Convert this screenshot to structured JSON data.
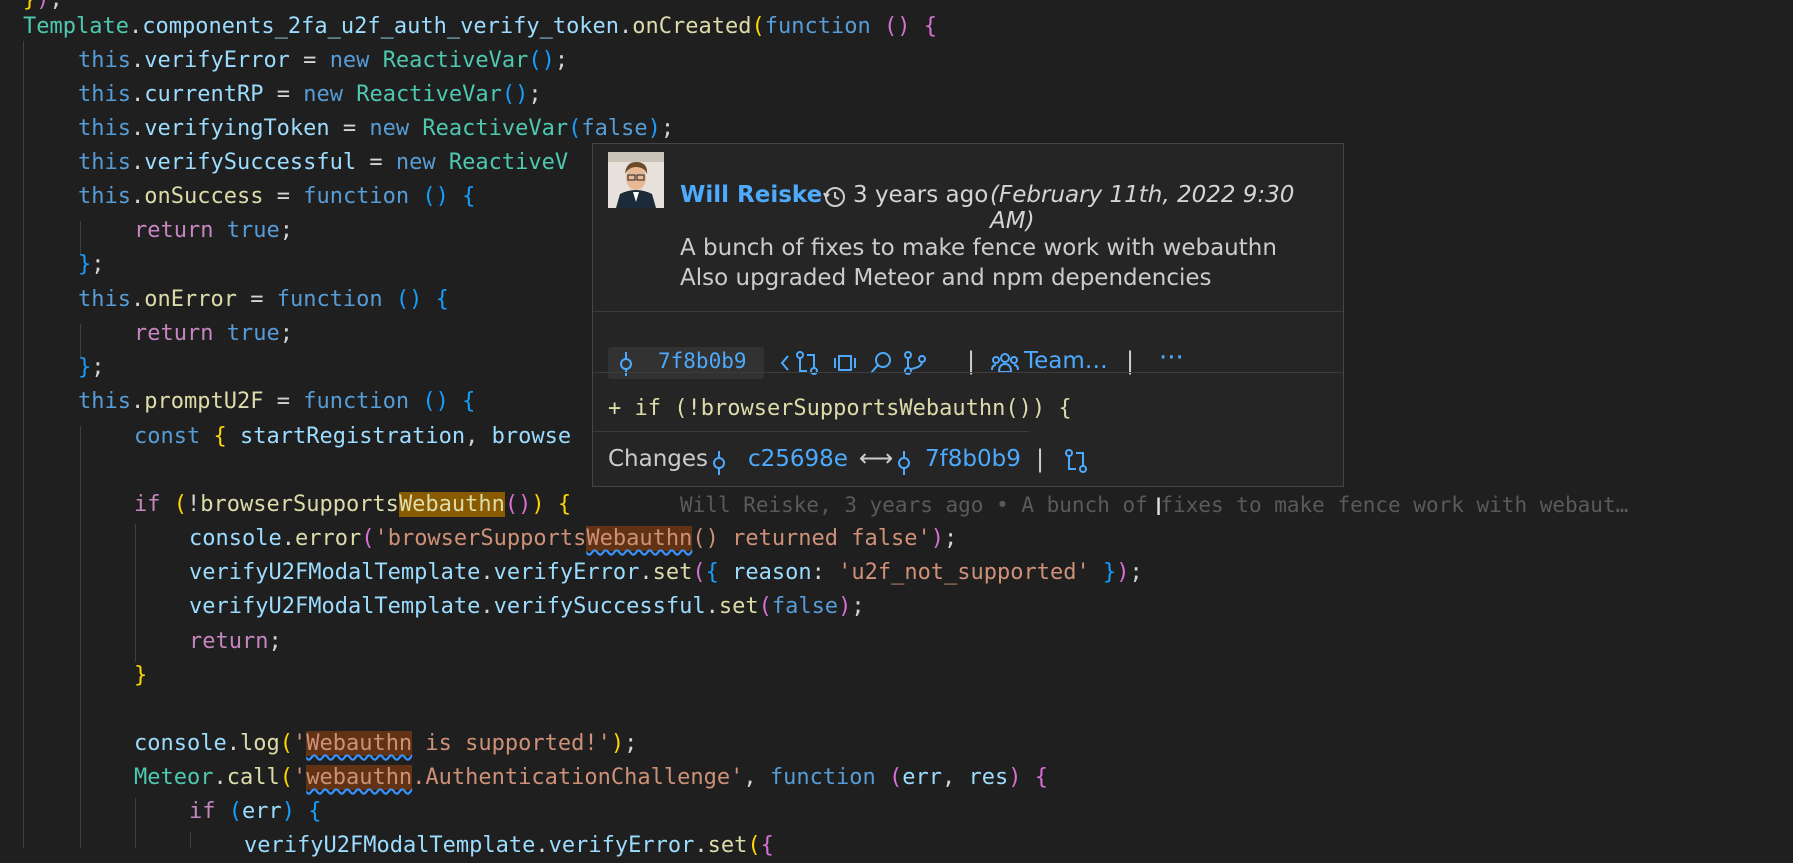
{
  "code_lines": [
    "});",
    "Template.components_2fa_u2f_auth_verify_token.onCreated(function () {",
    "this.verifyError = new ReactiveVar();",
    "this.currentRP = new ReactiveVar();",
    "this.verifyingToken = new ReactiveVar(false);",
    "this.verifySuccessful = new ReactiveV",
    "this.onSuccess = function () {",
    "return true;",
    "};",
    "this.onError = function () {",
    "return true;",
    "};",
    "this.promptU2F = function () {",
    "const { startRegistration, browse",
    "",
    "if (!browserSupportsWebauthn()) {",
    "console.error('browserSupportsWebauthn() returned false');",
    "verifyU2FModalTemplate.verifyError.set({ reason: 'u2f_not_supported' });",
    "verifyU2FModalTemplate.verifySuccessful.set(false);",
    "return;",
    "}",
    "",
    "console.log('Webauthn is supported!');",
    "Meteor.call('webauthn.AuthenticationChallenge', function (err, res) {",
    "if (err) {",
    "verifyU2FModalTemplate.verifyError.set({"
  ],
  "inline_blame": "Will Reiske, 3 years ago • A bunch of fixes to make fence work with webaut…",
  "hover": {
    "author": "Will Reiske",
    "relative_time": "3 years ago",
    "absolute_time": "(February 11th, 2022 9:30 AM)",
    "message_lines": [
      "A bunch of fixes to make fence work with webauthn",
      "Also upgraded Meteor and npm dependencies"
    ],
    "sha": "7f8b0b9",
    "team_label": "Team…",
    "more_label": "···",
    "diff_line": "+ if (!browserSupportsWebauthn()) {",
    "changes_label": "Changes",
    "from_sha": "c25698e",
    "to_sha": "7f8b0b9",
    "arrow": "⟷",
    "separator": "|",
    "icons": [
      "commit-icon",
      "chevron-left-icon",
      "compare-icon",
      "graph-icon",
      "search-icon",
      "branch-icon",
      "team-icon",
      "more-icon",
      "history-icon"
    ]
  },
  "colors": {
    "background": "#1f1f1f",
    "link": "#4daafc",
    "keyword": "#569cd6",
    "control": "#c586c0",
    "class": "#4ec9b0",
    "function": "#dcdcaa",
    "string": "#ce9178",
    "highlight": "#613214"
  }
}
